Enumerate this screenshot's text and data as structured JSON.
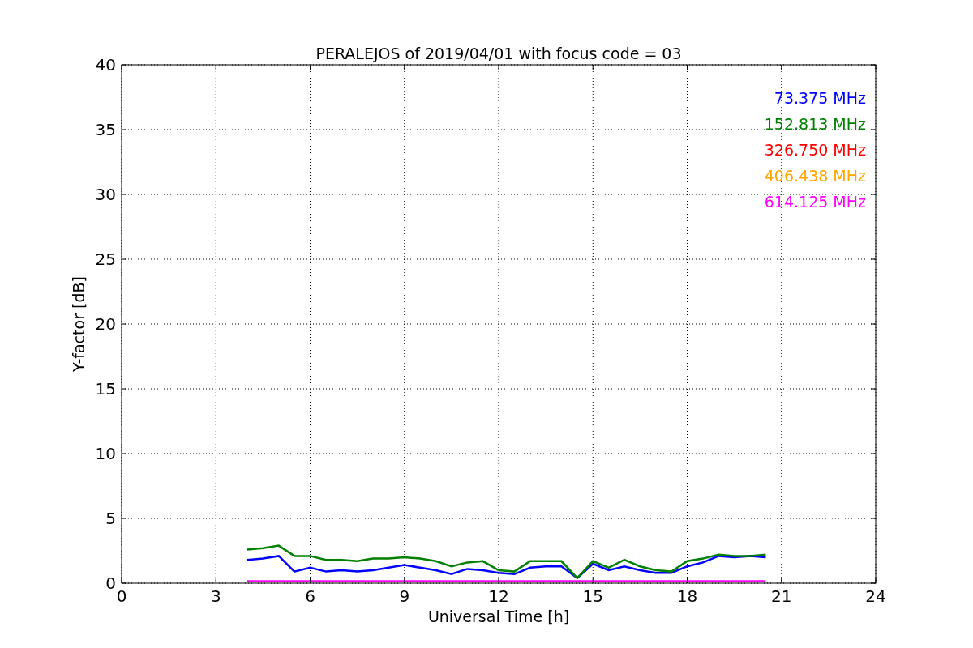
{
  "chart_data": {
    "type": "line",
    "title": "PERALEJOS of 2019/04/01 with focus code = 03",
    "xlabel": "Universal Time [h]",
    "ylabel": "Y-factor [dB]",
    "x": [
      4,
      4.5,
      5,
      5.5,
      6,
      6.5,
      7,
      7.5,
      8,
      8.5,
      9,
      9.5,
      10,
      10.5,
      11,
      11.5,
      12,
      12.5,
      13,
      13.5,
      14,
      14.5,
      15,
      15.5,
      16,
      16.5,
      17,
      17.5,
      18,
      18.5,
      19,
      19.5,
      20,
      20.5
    ],
    "series": [
      {
        "name": "73.375 MHz",
        "color": "#0000ff",
        "values": [
          1.8,
          1.9,
          2.1,
          0.9,
          1.2,
          0.9,
          1.0,
          0.9,
          1.0,
          1.2,
          1.4,
          1.2,
          1.0,
          0.7,
          1.1,
          1.0,
          0.8,
          0.7,
          1.2,
          1.3,
          1.3,
          0.4,
          1.5,
          1.0,
          1.3,
          1.0,
          0.8,
          0.8,
          1.3,
          1.6,
          2.1,
          2.0,
          2.1,
          2.0
        ]
      },
      {
        "name": "152.813 MHz",
        "color": "#008000",
        "values": [
          2.6,
          2.7,
          2.9,
          2.1,
          2.1,
          1.8,
          1.8,
          1.7,
          1.9,
          1.9,
          2.0,
          1.9,
          1.7,
          1.3,
          1.6,
          1.7,
          1.0,
          0.9,
          1.7,
          1.7,
          1.7,
          0.4,
          1.7,
          1.2,
          1.8,
          1.3,
          1.0,
          0.9,
          1.7,
          1.9,
          2.2,
          2.1,
          2.1,
          2.2
        ]
      },
      {
        "name": "326.750 MHz",
        "color": "#ff0000",
        "values": [
          null,
          null,
          null,
          null,
          null,
          null,
          null,
          null,
          null,
          null,
          null,
          null,
          null,
          null,
          null,
          null,
          null,
          null,
          null,
          null,
          null,
          null,
          null,
          null,
          null,
          null,
          null,
          null,
          null,
          null,
          null,
          null,
          null,
          null
        ]
      },
      {
        "name": "406.438 MHz",
        "color": "#ffa500",
        "values": [
          null,
          null,
          null,
          null,
          null,
          null,
          null,
          null,
          null,
          null,
          null,
          null,
          null,
          null,
          null,
          null,
          null,
          null,
          null,
          null,
          null,
          null,
          null,
          null,
          null,
          null,
          null,
          null,
          null,
          null,
          null,
          null,
          null,
          null
        ]
      },
      {
        "name": "614.125 MHz",
        "color": "#ff00ff",
        "values": [
          0.15,
          0.15,
          0.15,
          0.15,
          0.15,
          0.15,
          0.15,
          0.15,
          0.15,
          0.15,
          0.15,
          0.15,
          0.15,
          0.15,
          0.15,
          0.15,
          0.15,
          0.15,
          0.15,
          0.15,
          0.15,
          0.15,
          0.15,
          0.15,
          0.15,
          0.15,
          0.15,
          0.15,
          0.15,
          0.15,
          0.15,
          0.15,
          0.15,
          0.15
        ]
      }
    ],
    "grid": true,
    "xlim": [
      0,
      24
    ],
    "ylim": [
      0,
      40
    ],
    "xticks": [
      0,
      3,
      6,
      9,
      12,
      15,
      18,
      21,
      24
    ],
    "yticks": [
      0,
      5,
      10,
      15,
      20,
      25,
      30,
      35,
      40
    ]
  }
}
